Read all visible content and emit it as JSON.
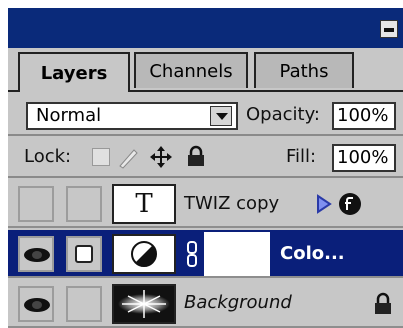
{
  "tabs": [
    {
      "label": "Layers",
      "active": true
    },
    {
      "label": "Channels",
      "active": false
    },
    {
      "label": "Paths",
      "active": false
    }
  ],
  "blend_mode": "Normal",
  "opacity_label": "Opacity:",
  "opacity_value": "100%",
  "lock_label": "Lock:",
  "fill_label": "Fill:",
  "fill_value": "100%",
  "layers": [
    {
      "name": "TWIZ copy",
      "thumb_glyph": "T",
      "visible": false,
      "selected": false
    },
    {
      "name": "Colo...",
      "visible": true,
      "selected": true
    },
    {
      "name": "Background",
      "visible": true,
      "selected": false
    }
  ],
  "colors": {
    "accent": "#0a1f7a",
    "panel": "#c7c7c7"
  }
}
